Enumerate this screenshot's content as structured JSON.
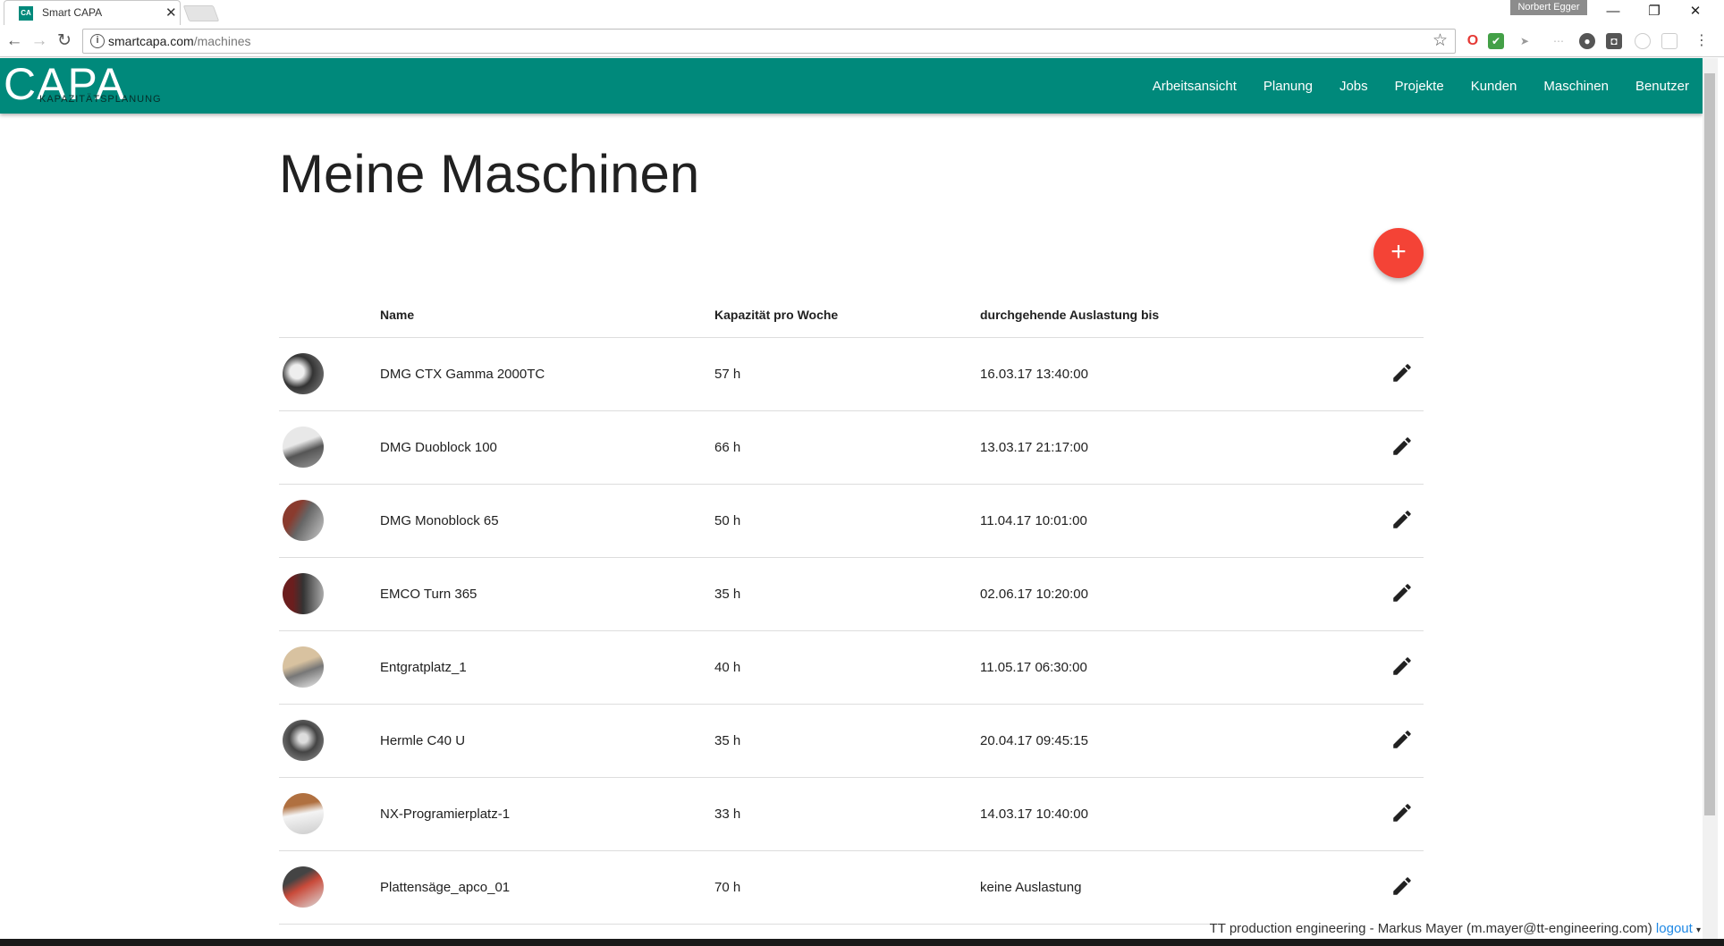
{
  "browser": {
    "tab_title": "Smart CAPA",
    "profile_name": "Norbert Egger",
    "url_host": "smartcapa.com",
    "url_path": "/machines"
  },
  "app": {
    "logo_main": "CAPA",
    "logo_sub": "KAPAZITÄTSPLANUNG",
    "nav": [
      "Arbeitsansicht",
      "Planung",
      "Jobs",
      "Projekte",
      "Kunden",
      "Maschinen",
      "Benutzer"
    ],
    "brand_color": "#00897b",
    "fab_color": "#f44336"
  },
  "page": {
    "title": "Meine Maschinen",
    "add_label": "+"
  },
  "table": {
    "headers": {
      "name": "Name",
      "capacity": "Kapazität pro Woche",
      "until": "durchgehende Auslastung bis"
    },
    "rows": [
      {
        "name": "DMG CTX Gamma 2000TC",
        "capacity": "57 h",
        "until": "16.03.17 13:40:00"
      },
      {
        "name": "DMG Duoblock 100",
        "capacity": "66 h",
        "until": "13.03.17 21:17:00"
      },
      {
        "name": "DMG Monoblock 65",
        "capacity": "50 h",
        "until": "11.04.17 10:01:00"
      },
      {
        "name": "EMCO Turn 365",
        "capacity": "35 h",
        "until": "02.06.17 10:20:00"
      },
      {
        "name": "Entgratplatz_1",
        "capacity": "40 h",
        "until": "11.05.17 06:30:00"
      },
      {
        "name": "Hermle C40 U",
        "capacity": "35 h",
        "until": "20.04.17 09:45:15"
      },
      {
        "name": "NX-Programierplatz-1",
        "capacity": "33 h",
        "until": "14.03.17 10:40:00"
      },
      {
        "name": "Plattensäge_apco_01",
        "capacity": "70 h",
        "until": "keine Auslastung"
      }
    ]
  },
  "footer": {
    "text": "TT production engineering - Markus Mayer (m.mayer@tt-engineering.com)",
    "logout": "logout"
  }
}
